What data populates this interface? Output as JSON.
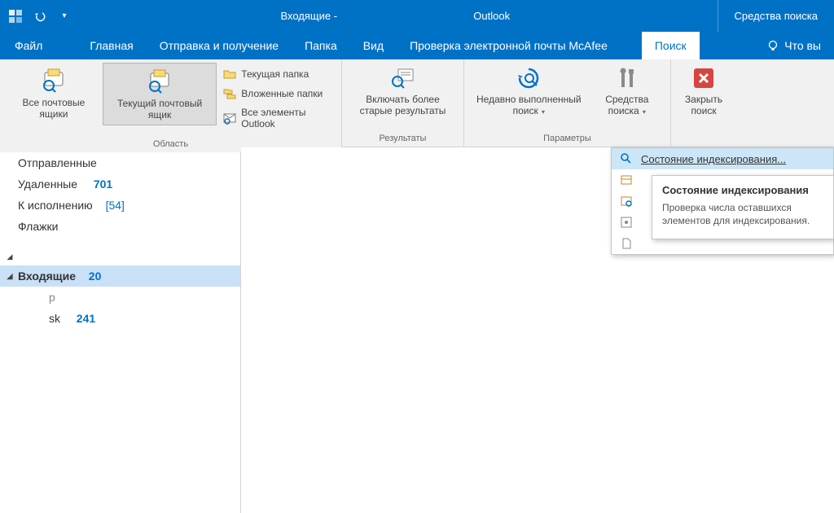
{
  "title_bar": {
    "prefix": "Входящие - ",
    "suffix": " Outlook",
    "context_tab": "Средства поиска"
  },
  "tabs": {
    "file": "Файл",
    "home": "Главная",
    "sendrecv": "Отправка и получение",
    "folder": "Папка",
    "view": "Вид",
    "mcafee": "Проверка электронной почты McAfee",
    "search": "Поиск",
    "tell": "Что вы"
  },
  "ribbon": {
    "group_scope": "Область",
    "group_results": "Результаты",
    "group_options": "Параметры",
    "all_mailboxes": "Все почтовые ящики",
    "current_mailbox": "Текущий почтовый ящик",
    "current_folder": "Текущая папка",
    "subfolders": "Вложенные папки",
    "all_outlook": "Все элементы Outlook",
    "include_older": "Включать более старые результаты",
    "recent_search": "Недавно выполненный поиск",
    "search_tools": "Средства поиска",
    "close_search": "Закрыть поиск"
  },
  "folders": {
    "sent": "Отправленные",
    "deleted": "Удаленные",
    "deleted_count": "701",
    "followup": "К исполнению",
    "followup_count": "[54]",
    "flags": "Флажки",
    "inbox": "Входящие",
    "inbox_count": "20",
    "sub_sk": "sk",
    "sub_sk_count": "241"
  },
  "menu": {
    "indexing_status": "Состояние индексирования..."
  },
  "tooltip": {
    "title": "Состояние индексирования",
    "body": "Проверка числа оставшихся элементов для индексирования."
  }
}
